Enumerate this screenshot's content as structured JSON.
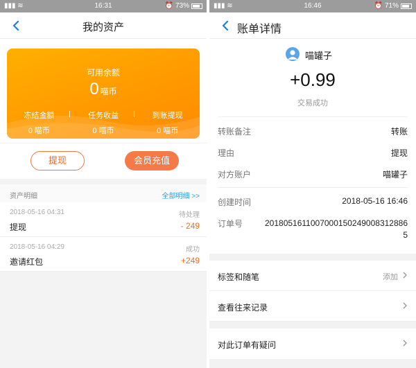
{
  "left": {
    "status": {
      "signal": "тİııı",
      "time": "16:31",
      "battery": "73%"
    },
    "header": {
      "title": "我的资产"
    },
    "card": {
      "label": "可用余额",
      "balance": "0",
      "unit": "喵币",
      "stats": [
        {
          "label": "冻结金额",
          "value": "0 喵币"
        },
        {
          "label": "任务收益",
          "value": "0 喵币"
        },
        {
          "label": "到账提现",
          "value": "0 喵币"
        }
      ]
    },
    "buttons": {
      "withdraw": "提现",
      "recharge": "会员充值"
    },
    "section": {
      "title": "资产明细",
      "link": "全部明细 >>"
    },
    "transactions": [
      {
        "date": "2018-05-16 04:31",
        "status": "待处理",
        "name": "提现",
        "amount": "- 249"
      },
      {
        "date": "2018-05-16 04:29",
        "status": "成功",
        "name": "邀请红包",
        "amount": "+249"
      }
    ]
  },
  "right": {
    "status": {
      "time": "16:46",
      "battery": "71%"
    },
    "header": {
      "title": "账单详情"
    },
    "user": {
      "name": "喵罐子"
    },
    "amount": "+0.99",
    "txn_status": "交易成功",
    "details": [
      {
        "key": "转账备注",
        "value": "转账"
      },
      {
        "key": "理由",
        "value": "提现"
      },
      {
        "key": "对方账户",
        "value": "喵罐子"
      }
    ],
    "created": {
      "key": "创建时间",
      "value": "2018-05-16 16:46"
    },
    "order": {
      "key": "订单号",
      "value": "2018051611007000150249008312886 5"
    },
    "menu": [
      {
        "label": "标签和随笔",
        "right": "添加"
      },
      {
        "label": "查看往来记录",
        "right": ""
      }
    ],
    "menu2": [
      {
        "label": "对此订单有疑问",
        "right": ""
      }
    ]
  },
  "colors": {
    "orange": "#ff9a00",
    "link": "#2aa0e6",
    "accent": "#f47a48"
  }
}
